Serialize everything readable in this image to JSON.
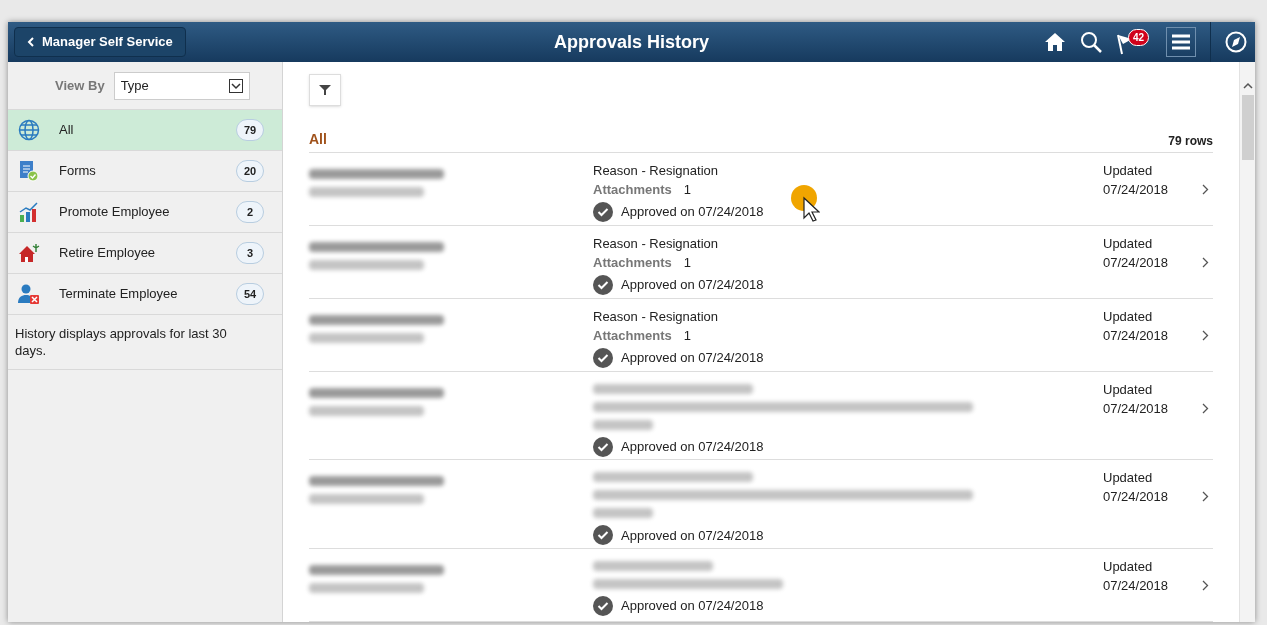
{
  "header": {
    "back_button": "Manager Self Service",
    "title": "Approvals History",
    "notification_count": "42"
  },
  "sidebar": {
    "view_by_label": "View By",
    "view_by_value": "Type",
    "items": [
      {
        "kind": "globe",
        "label": "All",
        "count": "79",
        "selected": true
      },
      {
        "kind": "forms",
        "label": "Forms",
        "count": "20",
        "selected": false
      },
      {
        "kind": "promote",
        "label": "Promote Employee",
        "count": "2",
        "selected": false
      },
      {
        "kind": "retire",
        "label": "Retire Employee",
        "count": "3",
        "selected": false
      },
      {
        "kind": "terminate",
        "label": "Terminate Employee",
        "count": "54",
        "selected": false
      }
    ],
    "note": "History displays approvals for last 30 days."
  },
  "content": {
    "section_title": "All",
    "row_count": "79 rows",
    "rows": [
      {
        "kind": "termination",
        "reason": "Reason - Resignation",
        "attachments_label": "Attachments",
        "attachments_count": "1",
        "status": "Approved on 07/24/2018",
        "updated_label": "Updated",
        "updated_date": "07/24/2018"
      },
      {
        "kind": "termination",
        "reason": "Reason - Resignation",
        "attachments_label": "Attachments",
        "attachments_count": "1",
        "status": "Approved on 07/24/2018",
        "updated_label": "Updated",
        "updated_date": "07/24/2018"
      },
      {
        "kind": "termination",
        "reason": "Reason - Resignation",
        "attachments_label": "Attachments",
        "attachments_count": "1",
        "status": "Approved on 07/24/2018",
        "updated_label": "Updated",
        "updated_date": "07/24/2018"
      },
      {
        "kind": "form",
        "status": "Approved on 07/24/2018",
        "updated_label": "Updated",
        "updated_date": "07/24/2018"
      },
      {
        "kind": "form",
        "status": "Approved on 07/24/2018",
        "updated_label": "Updated",
        "updated_date": "07/24/2018"
      },
      {
        "kind": "form_short",
        "status": "Approved on 07/24/2018",
        "updated_label": "Updated",
        "updated_date": "07/24/2018"
      }
    ]
  }
}
